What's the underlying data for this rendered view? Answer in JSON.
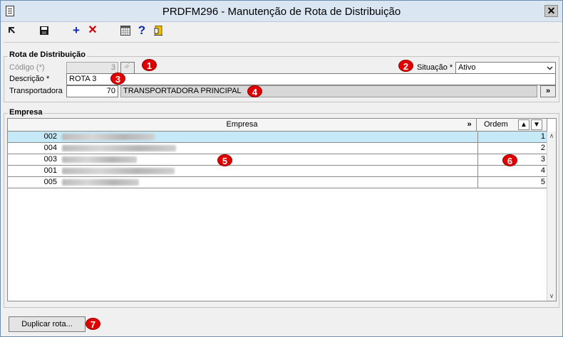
{
  "window": {
    "title": "PRDFM296 - Manutenção de Rota de Distribuição",
    "close_label": "✕"
  },
  "toolbar": {
    "icons": [
      "first-record-icon",
      "save-icon",
      "add-icon",
      "delete-icon",
      "calculator-icon",
      "help-icon",
      "exit-icon"
    ]
  },
  "rota": {
    "group_label": "Rota de Distribuição",
    "codigo_label": "Código (*)",
    "codigo_value": "3",
    "descricao_label": "Descrição *",
    "descricao_value": "ROTA 3",
    "transportadora_label": "Transportadora",
    "transportadora_code": "70",
    "transportadora_name": "TRANSPORTADORA PRINCIPAL",
    "lookup_label": "»",
    "situacao_label": "Situação *",
    "situacao_value": "Ativo"
  },
  "empresa": {
    "group_label": "Empresa",
    "columns": {
      "empresa": "Empresa",
      "ordem": "Ordem",
      "more": "»"
    },
    "rows": [
      {
        "code": "002",
        "ordem": "1"
      },
      {
        "code": "004",
        "ordem": "2"
      },
      {
        "code": "003",
        "ordem": "3"
      },
      {
        "code": "001",
        "ordem": "4"
      },
      {
        "code": "005",
        "ordem": "5"
      }
    ]
  },
  "footer": {
    "duplicar_label": "Duplicar rota..."
  },
  "markers": [
    "1",
    "2",
    "3",
    "4",
    "5",
    "6",
    "7"
  ],
  "colors": {
    "marker": "#e00000",
    "selected_row": "#c5e9f7",
    "titlebar": "#dbe6f3"
  }
}
